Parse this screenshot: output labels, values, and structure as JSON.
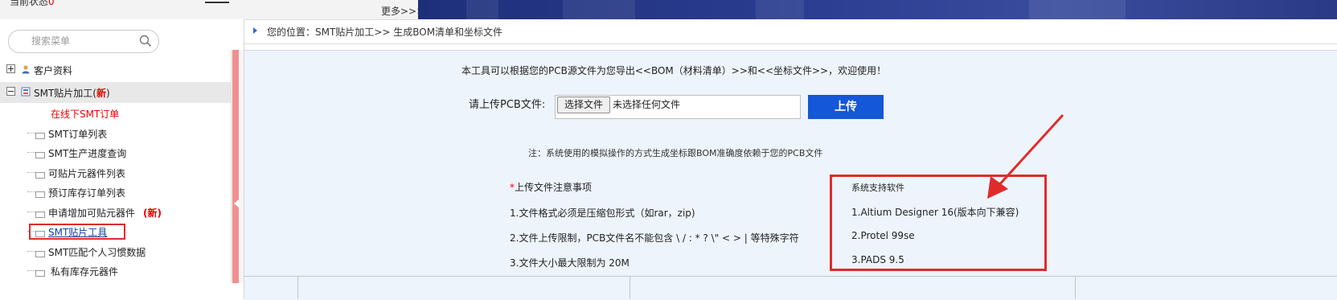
{
  "top": {
    "cut_text": "当前状态",
    "cut_count": "0",
    "more_link": "更多>>>"
  },
  "sidebar": {
    "search": {
      "placeholder": "搜索菜单"
    },
    "groups": [
      {
        "label": "客户资料",
        "expanded": false
      },
      {
        "label": "SMT贴片加工(",
        "new_tag": "新",
        "close": ")",
        "expanded": true
      }
    ],
    "items": [
      {
        "label": "在线下SMT订单",
        "style": "red"
      },
      {
        "label": "SMT订单列表"
      },
      {
        "label": "SMT生产进度查询"
      },
      {
        "label": "可贴片元器件列表"
      },
      {
        "label": "预订库存订单列表"
      },
      {
        "label": "申请增加可贴元器件",
        "new_tag": "(新)"
      },
      {
        "label": "SMT贴片工具",
        "style": "link",
        "highlighted": true
      },
      {
        "label": "SMT匹配个人习惯数据"
      },
      {
        "label": "私有库存元器件"
      }
    ]
  },
  "breadcrumb": {
    "text": "您的位置：SMT贴片加工>> 生成BOM清单和坐标文件"
  },
  "main": {
    "intro": "本工具可以根据您的PCB源文件为您导出<<BOM（材料清单）>>和<<坐标文件>>，欢迎使用！",
    "upload_label": "请上传PCB文件:",
    "choose_file_label": "选择文件",
    "file_status": "未选择任何文件",
    "upload_button": "上传",
    "note": "注：系统使用的模拟操作的方式生成坐标跟BOM准确度依赖于您的PCB文件",
    "notes_title_star": "*",
    "notes_title": "上传文件注意事项",
    "notes": [
      "1.文件格式必须是压缩包形式（如rar，zip)",
      "2.文件上传限制，PCB文件名不能包含 \\ / : * ? \\\" < > | 等特殊字符",
      "3.文件大小最大限制为 20M"
    ],
    "software_title": "系统支持软件",
    "software": [
      "1.Altium Designer 16(版本向下兼容)",
      "2.Protel 99se",
      "3.PADS 9.5"
    ]
  },
  "colors": {
    "banner": "#2a3c8f",
    "highlight_red": "#e02b2b",
    "upload_blue": "#1457d8",
    "link_blue": "#1a3a9c",
    "content_bg": "#eef4fb"
  },
  "icons": [
    "search-icon",
    "customer-icon",
    "smt-icon",
    "doc-icon",
    "arrow-icon"
  ]
}
